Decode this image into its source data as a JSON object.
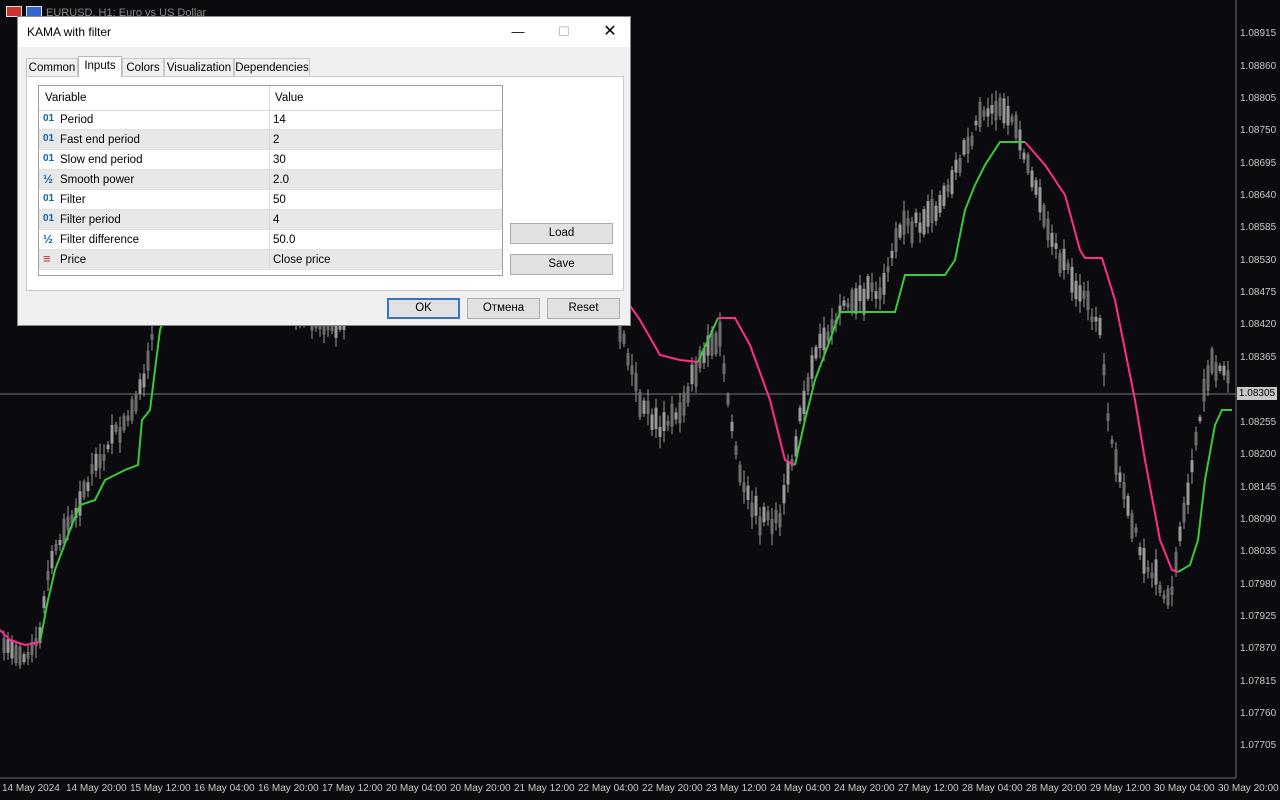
{
  "chart": {
    "title": "EURUSD, H1:  Euro vs US Dollar",
    "current_price": "1.08305",
    "price_axis": [
      "1.08915",
      "1.08860",
      "1.08805",
      "1.08750",
      "1.08695",
      "1.08640",
      "1.08585",
      "1.08530",
      "1.08475",
      "1.08420",
      "1.08365",
      "1.08255",
      "1.08200",
      "1.08145",
      "1.08090",
      "1.08035",
      "1.07980",
      "1.07925",
      "1.07870",
      "1.07815",
      "1.07760",
      "1.07705"
    ],
    "time_axis": [
      "14 May 2024",
      "14 May 20:00",
      "15 May 12:00",
      "16 May 04:00",
      "16 May 20:00",
      "17 May 12:00",
      "20 May 04:00",
      "20 May 20:00",
      "21 May 12:00",
      "22 May 04:00",
      "22 May 20:00",
      "23 May 12:00",
      "24 May 04:00",
      "24 May 20:00",
      "27 May 12:00",
      "28 May 04:00",
      "28 May 20:00",
      "29 May 12:00",
      "30 May 04:00",
      "30 May 20:00"
    ],
    "colors": {
      "background": "#0b0b0f",
      "candles": "#9a9a9a",
      "kama_up": "#3cc83c",
      "kama_down": "#ff2d8c"
    }
  },
  "dialog": {
    "title": "KAMA with filter",
    "tabs": [
      "Common",
      "Inputs",
      "Colors",
      "Visualization",
      "Dependencies"
    ],
    "active_tab": "Inputs",
    "columns": {
      "variable": "Variable",
      "value": "Value"
    },
    "rows": [
      {
        "icon": "integer-icon",
        "glyph": "01",
        "name": "Period",
        "value": "14"
      },
      {
        "icon": "integer-icon",
        "glyph": "01",
        "name": "Fast end period",
        "value": "2"
      },
      {
        "icon": "integer-icon",
        "glyph": "01",
        "name": "Slow end period",
        "value": "30"
      },
      {
        "icon": "fraction-icon",
        "glyph": "½",
        "name": "Smooth power",
        "value": "2.0"
      },
      {
        "icon": "integer-icon",
        "glyph": "01",
        "name": "Filter",
        "value": "50"
      },
      {
        "icon": "integer-icon",
        "glyph": "01",
        "name": "Filter period",
        "value": "4"
      },
      {
        "icon": "fraction-icon",
        "glyph": "½",
        "name": "Filter difference",
        "value": "50.0"
      },
      {
        "icon": "enum-icon",
        "glyph": "≡",
        "name": "Price",
        "value": "Close price"
      }
    ],
    "load_label": "Load",
    "save_label": "Save",
    "ok_label": "OK",
    "cancel_label": "Отмена",
    "reset_label": "Reset"
  }
}
